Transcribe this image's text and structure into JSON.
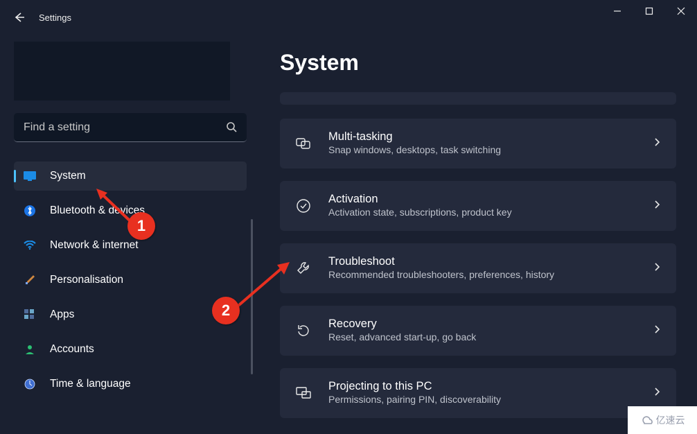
{
  "window": {
    "app_title": "Settings"
  },
  "search": {
    "placeholder": "Find a setting",
    "value": ""
  },
  "sidebar": {
    "items": [
      {
        "label": "System",
        "active": true
      },
      {
        "label": "Bluetooth & devices",
        "active": false
      },
      {
        "label": "Network & internet",
        "active": false
      },
      {
        "label": "Personalisation",
        "active": false
      },
      {
        "label": "Apps",
        "active": false
      },
      {
        "label": "Accounts",
        "active": false
      },
      {
        "label": "Time & language",
        "active": false
      }
    ]
  },
  "main": {
    "title": "System",
    "rows": [
      {
        "title": "Multi-tasking",
        "desc": "Snap windows, desktops, task switching"
      },
      {
        "title": "Activation",
        "desc": "Activation state, subscriptions, product key"
      },
      {
        "title": "Troubleshoot",
        "desc": "Recommended troubleshooters, preferences, history"
      },
      {
        "title": "Recovery",
        "desc": "Reset, advanced start-up, go back"
      },
      {
        "title": "Projecting to this PC",
        "desc": "Permissions, pairing PIN, discoverability"
      }
    ]
  },
  "annotations": {
    "1": "1",
    "2": "2"
  },
  "watermark": "亿速云"
}
